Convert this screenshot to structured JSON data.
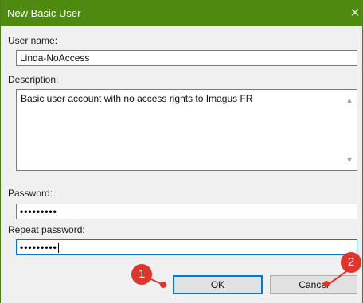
{
  "window": {
    "title": "New Basic User",
    "close_glyph": "✕",
    "titlebar_color": "#4f8a10"
  },
  "form": {
    "username_label": "User name:",
    "username_value": "Linda-NoAccess",
    "description_label": "Description:",
    "description_value": "Basic user account with no access rights to Imagus FR",
    "password_label": "Password:",
    "password_value": "•••••••••",
    "repeat_password_label": "Repeat password:",
    "repeat_password_value": "•••••••••"
  },
  "buttons": {
    "ok_label": "OK",
    "cancel_label": "Cancel"
  },
  "callouts": [
    {
      "number": "1",
      "target": "ok-button",
      "color": "#e0352b"
    },
    {
      "number": "2",
      "target": "cancel-button",
      "color": "#e0352b"
    }
  ]
}
